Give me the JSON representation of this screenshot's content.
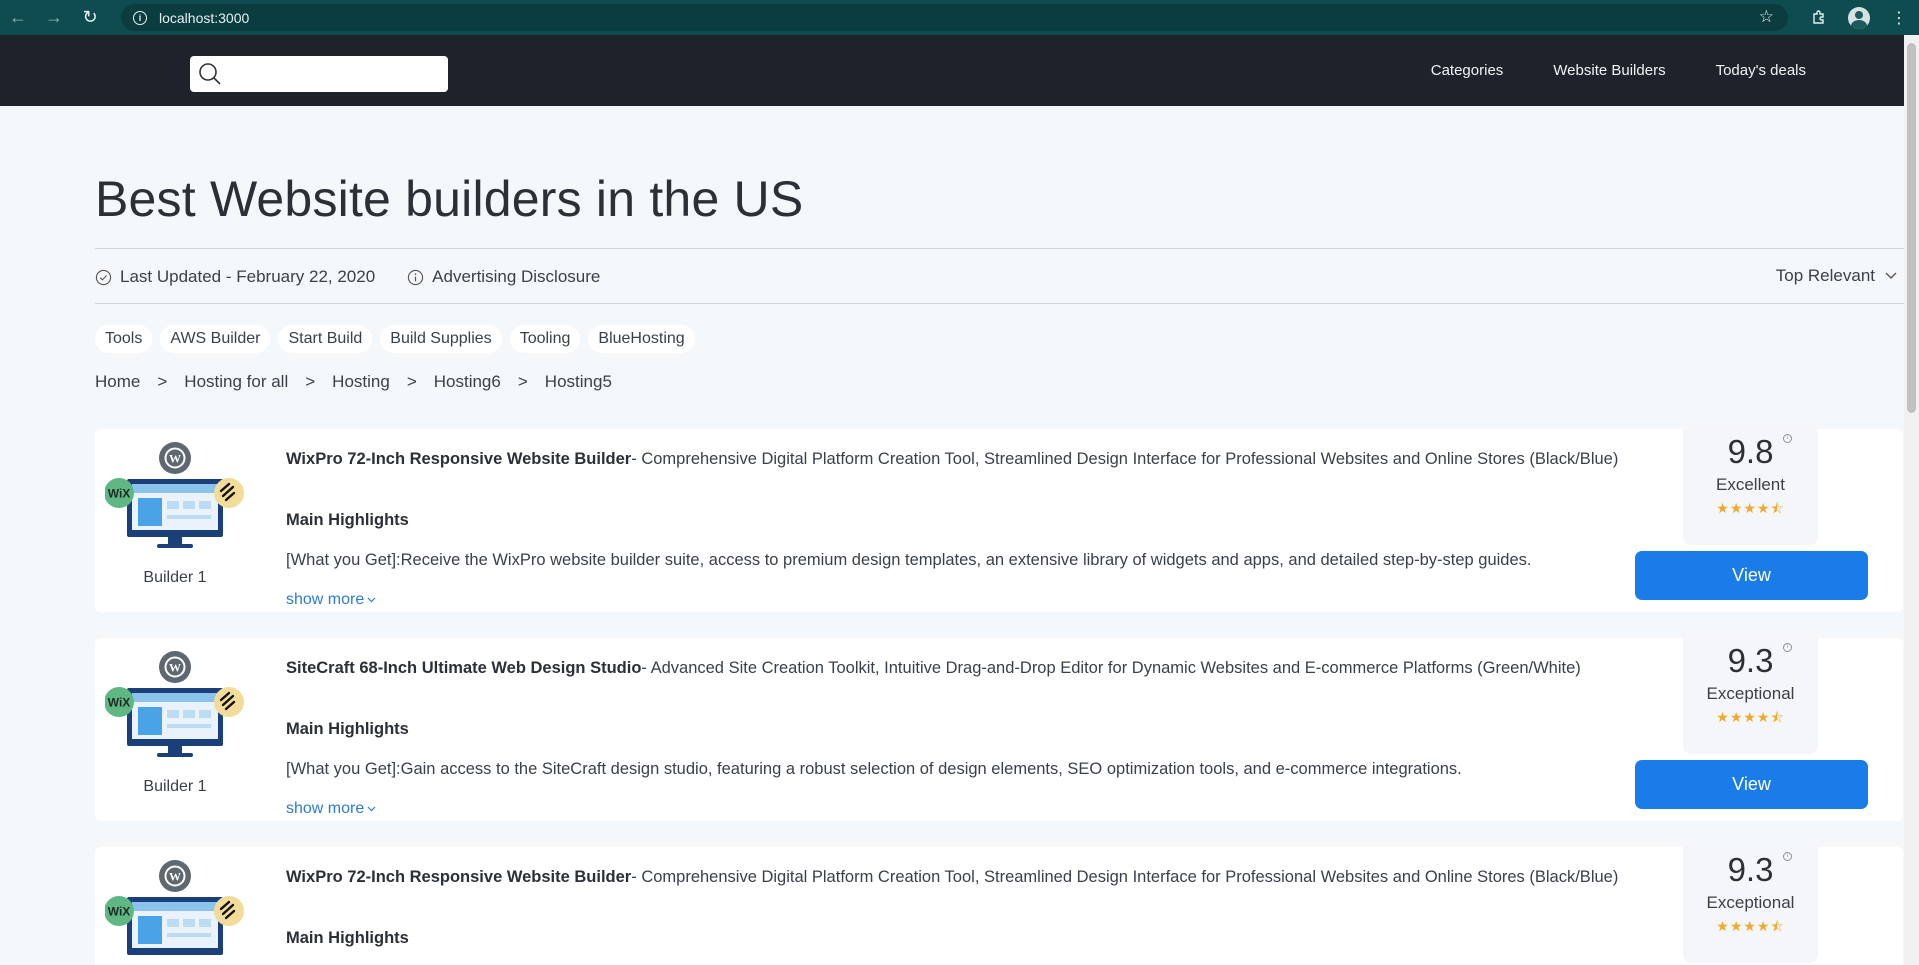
{
  "browser": {
    "url": "localhost:3000"
  },
  "header": {
    "search_placeholder": "",
    "nav": [
      "Categories",
      "Website Builders",
      "Today's deals"
    ]
  },
  "page": {
    "title": "Best Website builders in the US",
    "last_updated": "Last Updated - February 22, 2020",
    "disclosure": "Advertising Disclosure",
    "sort": "Top Relevant",
    "chips": [
      "Tools",
      "AWS Builder",
      "Start Build",
      "Build Supplies",
      "Tooling",
      "BlueHosting"
    ],
    "breadcrumbs": [
      "Home",
      "Hosting for all",
      "Hosting",
      "Hosting6",
      "Hosting5"
    ],
    "breadcrumb_separator": ">"
  },
  "cards": [
    {
      "caption": "Builder 1",
      "name": "WixPro 72-Inch Responsive Website Builder",
      "subtitle": "- Comprehensive Digital Platform Creation Tool, Streamlined Design Interface for Professional Websites and Online Stores (Black/Blue)",
      "highlights_label": "Main Highlights",
      "description": "[What you Get]:Receive the WixPro website builder suite, access to premium design templates, an extensive library of widgets and apps, and detailed step-by-step guides.",
      "show_more": "show more",
      "score": "9.8",
      "rating_label": "Excellent",
      "stars": "★★★★⯪",
      "button": "View"
    },
    {
      "caption": "Builder 1",
      "name": "SiteCraft 68-Inch Ultimate Web Design Studio",
      "subtitle": "- Advanced Site Creation Toolkit, Intuitive Drag-and-Drop Editor for Dynamic Websites and E-commerce Platforms (Green/White)",
      "highlights_label": "Main Highlights",
      "description": "[What you Get]:Gain access to the SiteCraft design studio, featuring a robust selection of design elements, SEO optimization tools, and e-commerce integrations.",
      "show_more": "show more",
      "score": "9.3",
      "rating_label": "Exceptional",
      "stars": "★★★★⯪",
      "button": "View"
    },
    {
      "caption": "",
      "name": "WixPro 72-Inch Responsive Website Builder",
      "subtitle": "- Comprehensive Digital Platform Creation Tool, Streamlined Design Interface for Professional Websites and Online Stores (Black/Blue)",
      "highlights_label": "Main Highlights",
      "description": "",
      "show_more": "",
      "score": "9.3",
      "rating_label": "Exceptional",
      "stars": "★★★★⯪",
      "button": ""
    }
  ],
  "colors": {
    "chrome": "#0f4c4f",
    "header": "#1e232b",
    "accent": "#1a7ce8",
    "star": "#f0a92a",
    "background": "#f5f8fb"
  }
}
